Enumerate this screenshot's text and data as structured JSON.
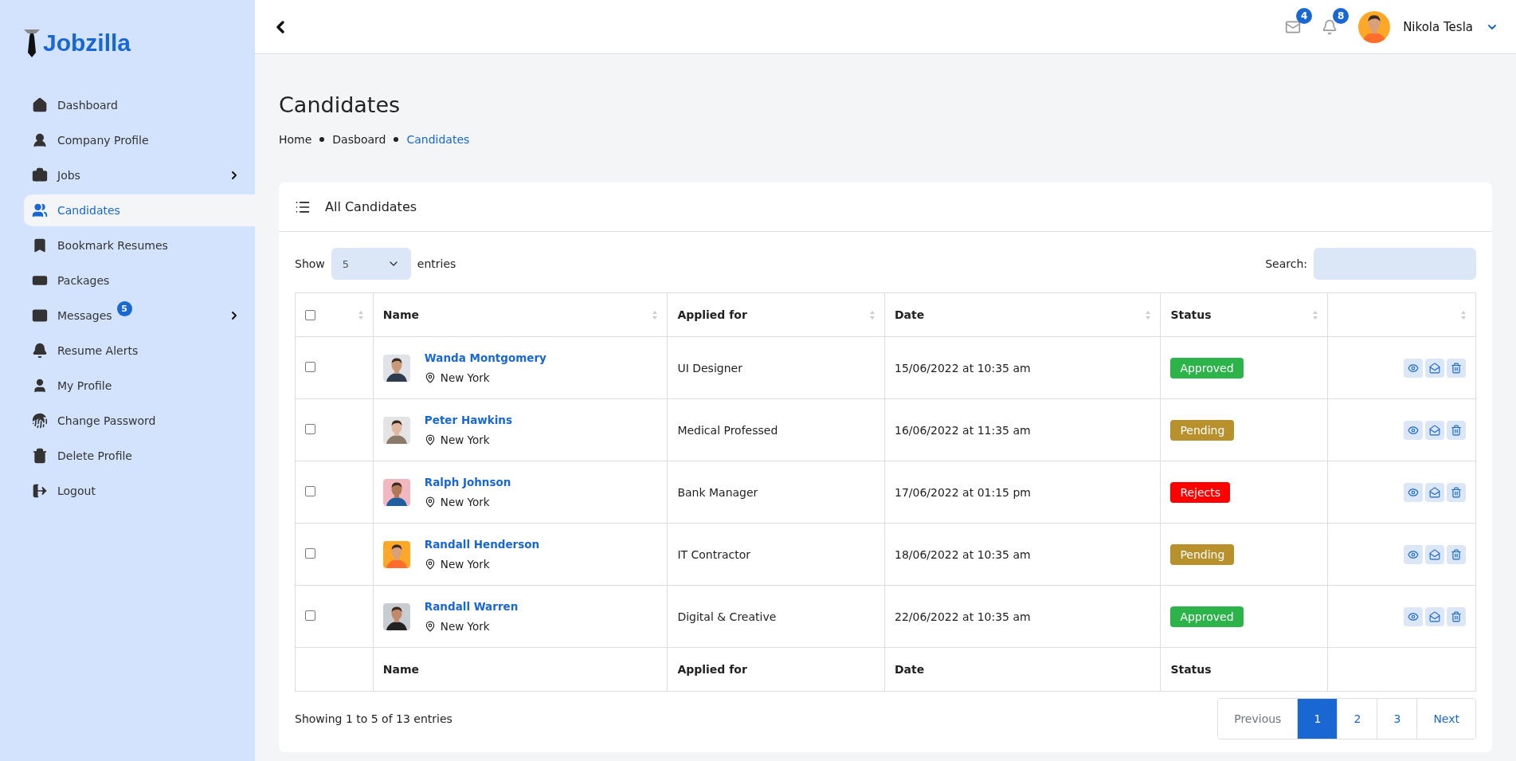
{
  "logo": {
    "text": "Jobzilla"
  },
  "sidebar": {
    "items": [
      {
        "label": "Dashboard",
        "selected": false,
        "submenu": false
      },
      {
        "label": "Company Profile",
        "selected": false,
        "submenu": false
      },
      {
        "label": "Jobs",
        "selected": false,
        "submenu": true
      },
      {
        "label": "Candidates",
        "selected": true,
        "submenu": false
      },
      {
        "label": "Bookmark Resumes",
        "selected": false,
        "submenu": false
      },
      {
        "label": "Packages",
        "selected": false,
        "submenu": false
      },
      {
        "label": "Messages",
        "selected": false,
        "submenu": true,
        "badge": "5"
      },
      {
        "label": "Resume Alerts",
        "selected": false,
        "submenu": false
      },
      {
        "label": "My Profile",
        "selected": false,
        "submenu": false
      },
      {
        "label": "Change Password",
        "selected": false,
        "submenu": false
      },
      {
        "label": "Delete Profile",
        "selected": false,
        "submenu": false
      },
      {
        "label": "Logout",
        "selected": false,
        "submenu": false
      }
    ]
  },
  "header": {
    "mail_count": "4",
    "notification_count": "8",
    "user_name": "Nikola Tesla"
  },
  "page": {
    "title": "Candidates",
    "breadcrumb": [
      {
        "label": "Home",
        "selected": false
      },
      {
        "label": "Dasboard",
        "selected": false
      },
      {
        "label": "Candidates",
        "selected": true
      }
    ]
  },
  "card": {
    "title": "All Candidates",
    "show_label": "Show",
    "entries_value": "5",
    "entries_label": "entries",
    "search_label": "Search:",
    "table": {
      "header_checked": false,
      "columns": [
        "Name",
        "Applied for",
        "Date",
        "Status"
      ],
      "rows": [
        {
          "checked": false,
          "name": "Wanda Montgomery",
          "location": "New York",
          "applied_for": "UI Designer",
          "date": "15/06/2022 at 10:35 am",
          "status": {
            "label": "Approved",
            "color": "#2cb34a"
          }
        },
        {
          "checked": false,
          "name": "Peter Hawkins",
          "location": "New York",
          "applied_for": "Medical Professed",
          "date": "16/06/2022 at 11:35 am",
          "status": {
            "label": "Pending",
            "color": "#b8912d"
          }
        },
        {
          "checked": false,
          "name": "Ralph Johnson",
          "location": "New York",
          "applied_for": "Bank Manager",
          "date": "17/06/2022 at 01:15 pm",
          "status": {
            "label": "Rejects",
            "color": "#ff0000"
          }
        },
        {
          "checked": false,
          "name": "Randall Henderson",
          "location": "New York",
          "applied_for": "IT Contractor",
          "date": "18/06/2022 at 10:35 am",
          "status": {
            "label": "Pending",
            "color": "#b8912d"
          }
        },
        {
          "checked": false,
          "name": "Randall Warren",
          "location": "New York",
          "applied_for": "Digital & Creative",
          "date": "22/06/2022 at 10:35 am",
          "status": {
            "label": "Approved",
            "color": "#2cb34a"
          }
        }
      ],
      "footer_columns": [
        "Name",
        "Applied for",
        "Date",
        "Status"
      ]
    },
    "info": "Showing 1 to 5 of 13 entries",
    "pagination": [
      {
        "label": "Previous",
        "selected": false,
        "disabled": true
      },
      {
        "label": "1",
        "selected": true,
        "disabled": false
      },
      {
        "label": "2",
        "selected": false,
        "disabled": false
      },
      {
        "label": "3",
        "selected": false,
        "disabled": false
      },
      {
        "label": "Next",
        "selected": false,
        "disabled": false
      }
    ]
  }
}
